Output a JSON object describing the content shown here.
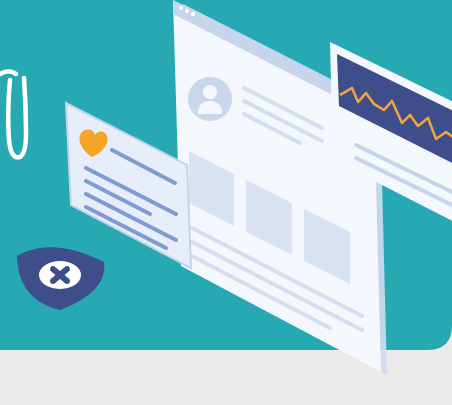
{
  "illustration": {
    "title_glyph_fragment": "",
    "colors": {
      "teal_background": "#27a9b3",
      "floor": "#ebeae9",
      "window_frame": "#f4f7fb",
      "window_accent": "#c9d6ec",
      "placeholder_lines": "#c6d4ea",
      "card_fill": "#e7eefa",
      "heart": "#f4a428",
      "monitor_bg": "#3d4e8b",
      "monitor_wave": "#f2a63a",
      "shield": "#3d4e8b",
      "shield_cross": "#ffffff"
    },
    "icons": [
      "profile-avatar-icon",
      "heart-icon",
      "heartbeat-wave-icon",
      "medical-cross-shield-icon"
    ]
  }
}
